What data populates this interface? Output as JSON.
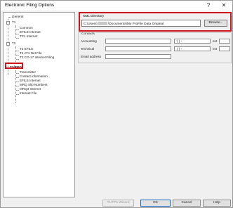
{
  "window": {
    "title": "Electronic Filing Options",
    "help_label": "?",
    "close_label": "✕"
  },
  "tree": {
    "items": [
      {
        "label": "General"
      },
      {
        "label": "T1"
      },
      {
        "label": "Common"
      },
      {
        "label": "EFILE Internet"
      },
      {
        "label": "TP1 Internet"
      },
      {
        "label": "T2"
      },
      {
        "label": "T2 EFILE"
      },
      {
        "label": "T2 AT1 Net File"
      },
      {
        "label": "T2 CO-17 Internet Filing"
      },
      {
        "label": "T3/RRQ"
      },
      {
        "label": "Transmitter"
      },
      {
        "label": "Contact information"
      },
      {
        "label": "EFILE Internet"
      },
      {
        "label": "MRQ Slip Numbers"
      },
      {
        "label": "MRQ3 Internet"
      },
      {
        "label": "Internet File"
      }
    ],
    "expander_minus": "−"
  },
  "xml_directory": {
    "label": "XML Directory",
    "value_prefix": "C:\\Users\\",
    "value_suffix": "\\Documents\\My ProFile Data Original",
    "browse_label": "Browse..."
  },
  "contacts": {
    "group_label": "Contacts",
    "accounting_label": "Accounting",
    "technical_label": "Technical",
    "email_label": "Email address",
    "phone_placeholder": "(   )   -",
    "ext_label": "ext"
  },
  "buttons": {
    "wizard": "T1/TP1 Wizard",
    "ok": "OK",
    "cancel": "Cancel",
    "help": "Help"
  },
  "colors": {
    "highlight": "#d0121b",
    "dialog_bg": "#f0f0f0"
  }
}
